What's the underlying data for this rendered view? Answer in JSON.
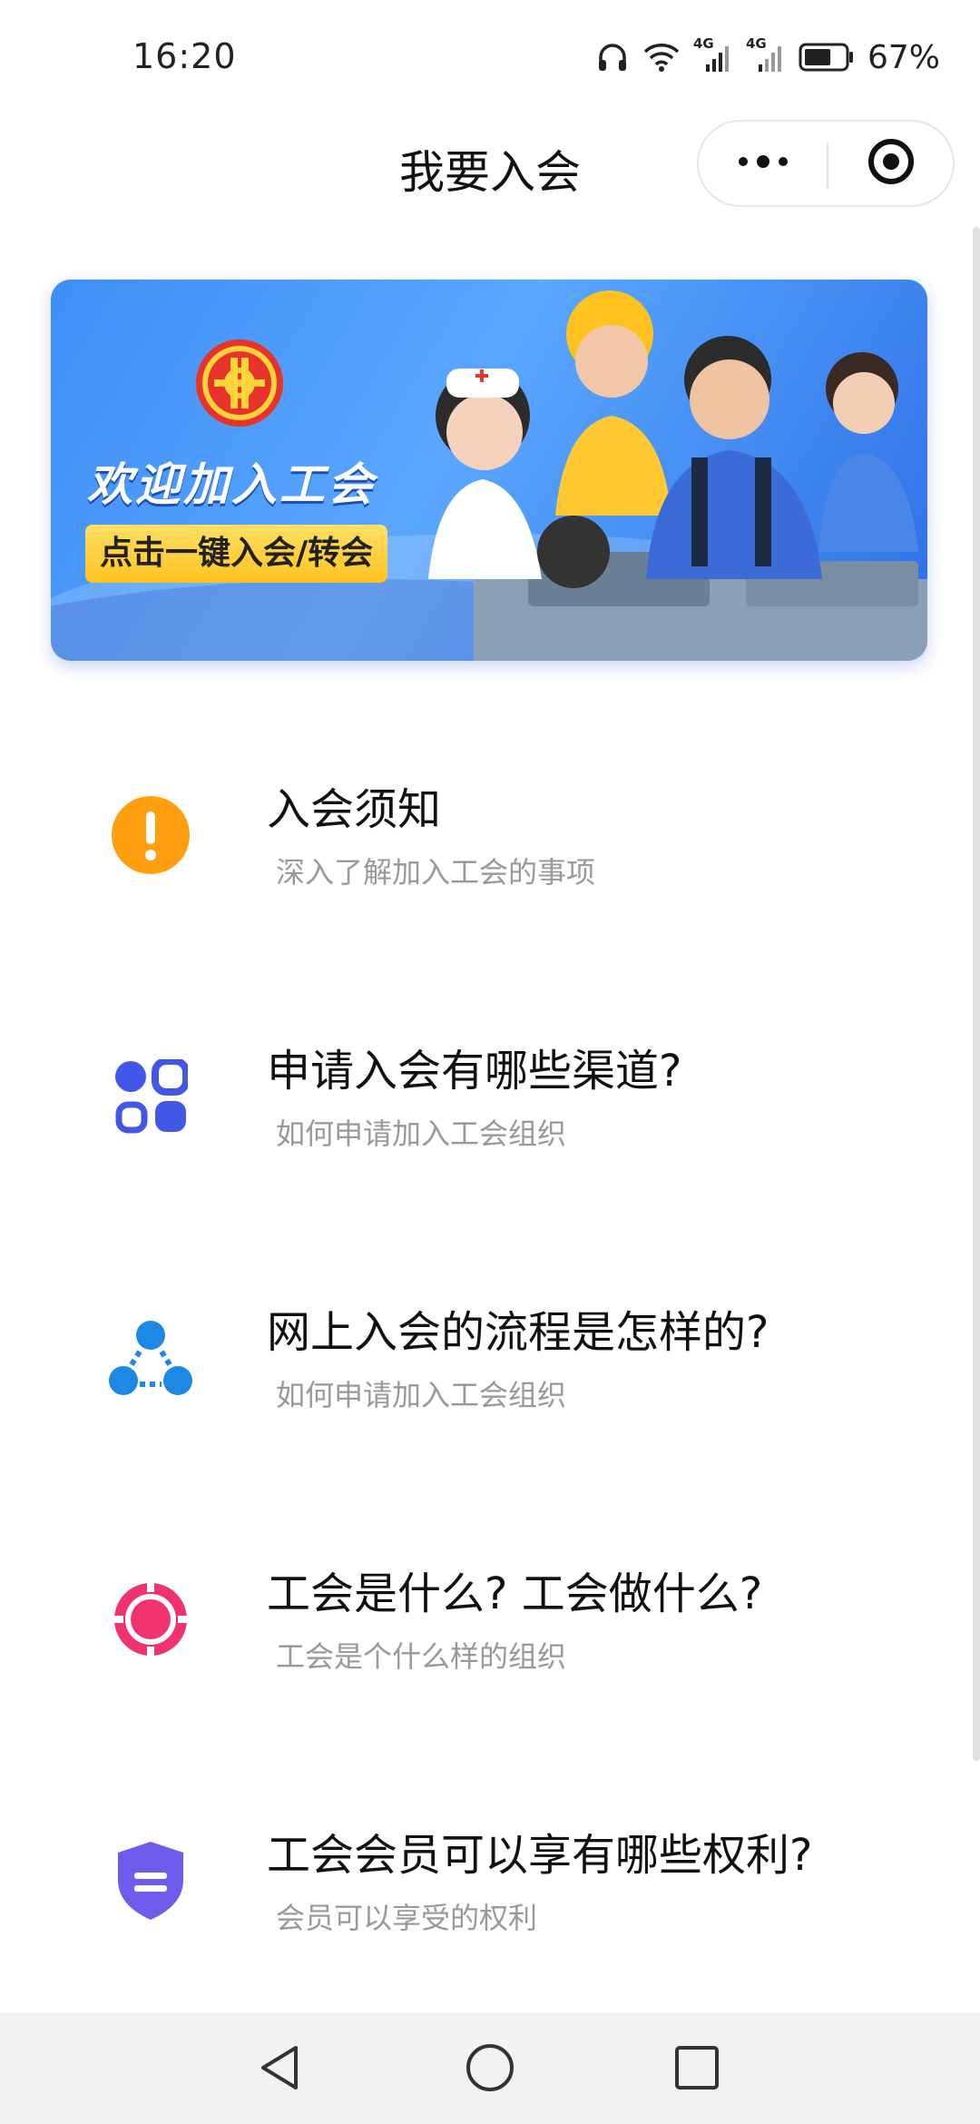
{
  "status_bar": {
    "time": "16:20",
    "signal_1_label": "4G",
    "signal_2_label": "4G",
    "battery_percent": "67%",
    "battery_level": 0.67,
    "icons": [
      "headphones-icon",
      "wifi-icon",
      "signal-icon",
      "signal-icon",
      "battery-icon"
    ]
  },
  "header": {
    "title": "我要入会",
    "more_icon": "more-dots-icon",
    "close_icon": "target-close-icon"
  },
  "banner": {
    "welcome_text": "欢迎加入工会",
    "cta_label": "点击一键入会/转会",
    "logo_icon": "union-emblem-icon"
  },
  "list": [
    {
      "title": "入会须知",
      "subtitle": "深入了解加入工会的事项",
      "icon": "exclamation-circle-icon",
      "color": "#FF9F0F"
    },
    {
      "title": "申请入会有哪些渠道?",
      "subtitle": "如何申请加入工会组织",
      "icon": "apps-grid-icon",
      "color": "#4257E8"
    },
    {
      "title": "网上入会的流程是怎样的?",
      "subtitle": "如何申请加入工会组织",
      "icon": "process-nodes-icon",
      "color": "#1E88E5"
    },
    {
      "title": "工会是什么? 工会做什么?",
      "subtitle": "工会是个什么样的组织",
      "icon": "target-ring-icon",
      "color": "#F0336F"
    },
    {
      "title": "工会会员可以享有哪些权利?",
      "subtitle": "会员可以享受的权利",
      "icon": "shield-icon",
      "color": "#6D5CEB"
    }
  ],
  "navbar": {
    "back_icon": "back-triangle-icon",
    "home_icon": "home-circle-icon",
    "recents_icon": "recents-square-icon"
  }
}
